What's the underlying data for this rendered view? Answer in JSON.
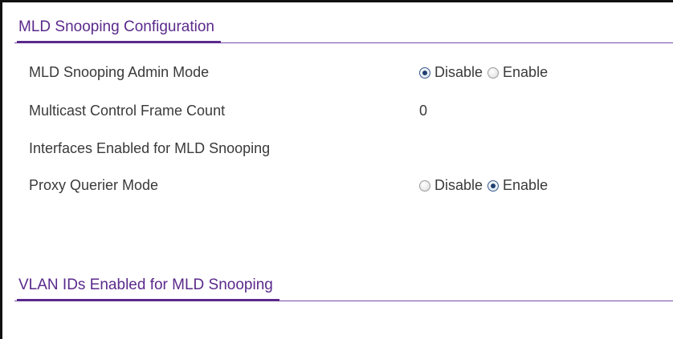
{
  "mld_config": {
    "title": "MLD Snooping Configuration",
    "admin_mode": {
      "label": "MLD Snooping Admin Mode",
      "options": [
        "Disable",
        "Enable"
      ],
      "selected": "Disable"
    },
    "frame_count": {
      "label": "Multicast Control Frame Count",
      "value": "0"
    },
    "interfaces": {
      "label": "Interfaces Enabled for MLD Snooping",
      "value": ""
    },
    "proxy_querier": {
      "label": "Proxy Querier Mode",
      "options": [
        "Disable",
        "Enable"
      ],
      "selected": "Enable"
    }
  },
  "vlan_section": {
    "title": "VLAN IDs Enabled for MLD Snooping"
  }
}
